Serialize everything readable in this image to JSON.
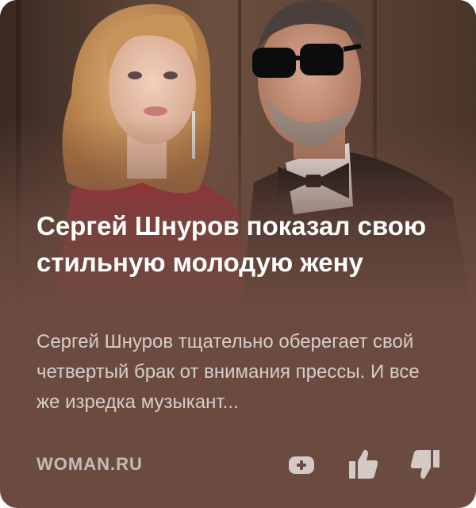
{
  "article": {
    "title": "Сергей Шнуров показал свою стильную молодую жену",
    "snippet": "Сергей Шнуров тщательно оберегает свой четвертый брак от внимания прессы. И все же изредка музыкант...",
    "source": "WOMAN.RU"
  },
  "photo": {
    "description_icon": "photo-couple-image"
  },
  "actions": {
    "add_icon": "add-to-feed-icon",
    "like_icon": "thumbs-up-icon",
    "dislike_icon": "thumbs-down-icon"
  },
  "colors": {
    "card_background": "#6b4a3f",
    "title": "#ffffff",
    "snippet": "rgba(255,255,255,0.72)",
    "source": "rgba(255,255,255,0.62)",
    "icons": "rgba(255,255,255,0.70)"
  }
}
